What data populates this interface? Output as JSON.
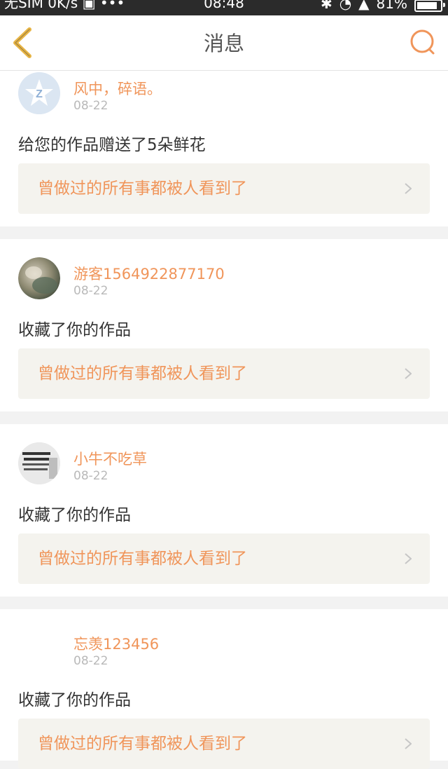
{
  "status_bar": {
    "carrier": "无SIM",
    "speed": "0K/s",
    "dots": "•••",
    "time": "08:48",
    "battery": "81%",
    "battery_level": 0.81
  },
  "header": {
    "title": "消息"
  },
  "colors": {
    "accent": "#f0955a",
    "back_arrow": "#e8b545",
    "work_box_bg": "#f4f3ee",
    "page_bg": "#f2f2f2"
  },
  "messages": [
    {
      "username": "风中，碎语。",
      "date": "08-22",
      "action": "给您的作品赠送了5朵鲜花",
      "work_title": "曾做过的所有事都被人看到了",
      "avatar": "qq-avatar-icon"
    },
    {
      "username": "游客1564922877170",
      "date": "08-22",
      "action": "收藏了你的作品",
      "work_title": "曾做过的所有事都被人看到了",
      "avatar": "photo-avatar"
    },
    {
      "username": "小牛不吃草",
      "date": "08-22",
      "action": "收藏了你的作品",
      "work_title": "曾做过的所有事都被人看到了",
      "avatar": "text-image-avatar"
    },
    {
      "username": "忘羡123456",
      "date": "08-22",
      "action": "收藏了你的作品",
      "work_title": "曾做过的所有事都被人看到了",
      "avatar": "empty-avatar"
    }
  ]
}
